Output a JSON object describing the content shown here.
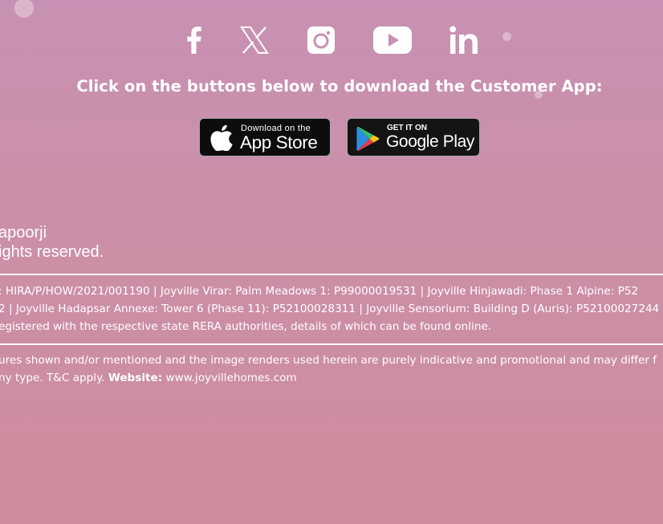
{
  "social": {
    "icons": [
      "facebook-icon",
      "x-icon",
      "instagram-icon",
      "youtube-icon",
      "linkedin-icon"
    ]
  },
  "cta": {
    "text": "Click on the buttons below to download the Customer App:"
  },
  "app_store": {
    "small": "Download on the",
    "big": "App Store"
  },
  "google_play": {
    "small": "GET IT ON",
    "big": "Google Play"
  },
  "copyright": {
    "line1": "apoorji",
    "line2": "ights reserved."
  },
  "rera": {
    "line1": ": HIRA/P/HOW/2021/001190 | Joyville Virar: Palm Meadows 1: P99000019531 | Joyville Hinjawadi: Phase 1 Alpine: P52",
    "line2": "2 | Joyville Hadapsar Annexe: Tower 6 (Phase 11): P52100028311 | Joyville Sensorium: Building D (Auris): P52100027244 | |",
    "line3": "egistered with the respective state RERA authorities, details of which can be found online."
  },
  "disclaimer": {
    "line1": "ures shown and/or mentioned and the image renders used herein are purely indicative and promotional and may differ f",
    "line2_prefix": "ny type. T&C apply. ",
    "website_label": "Website:",
    "website_url": " www.joyvillehomes.com"
  },
  "colors": {
    "background_top": "#c891b3",
    "background_bottom": "#cf8c9c",
    "badge_bg": "#0d0d0d",
    "text": "#ffffff"
  }
}
